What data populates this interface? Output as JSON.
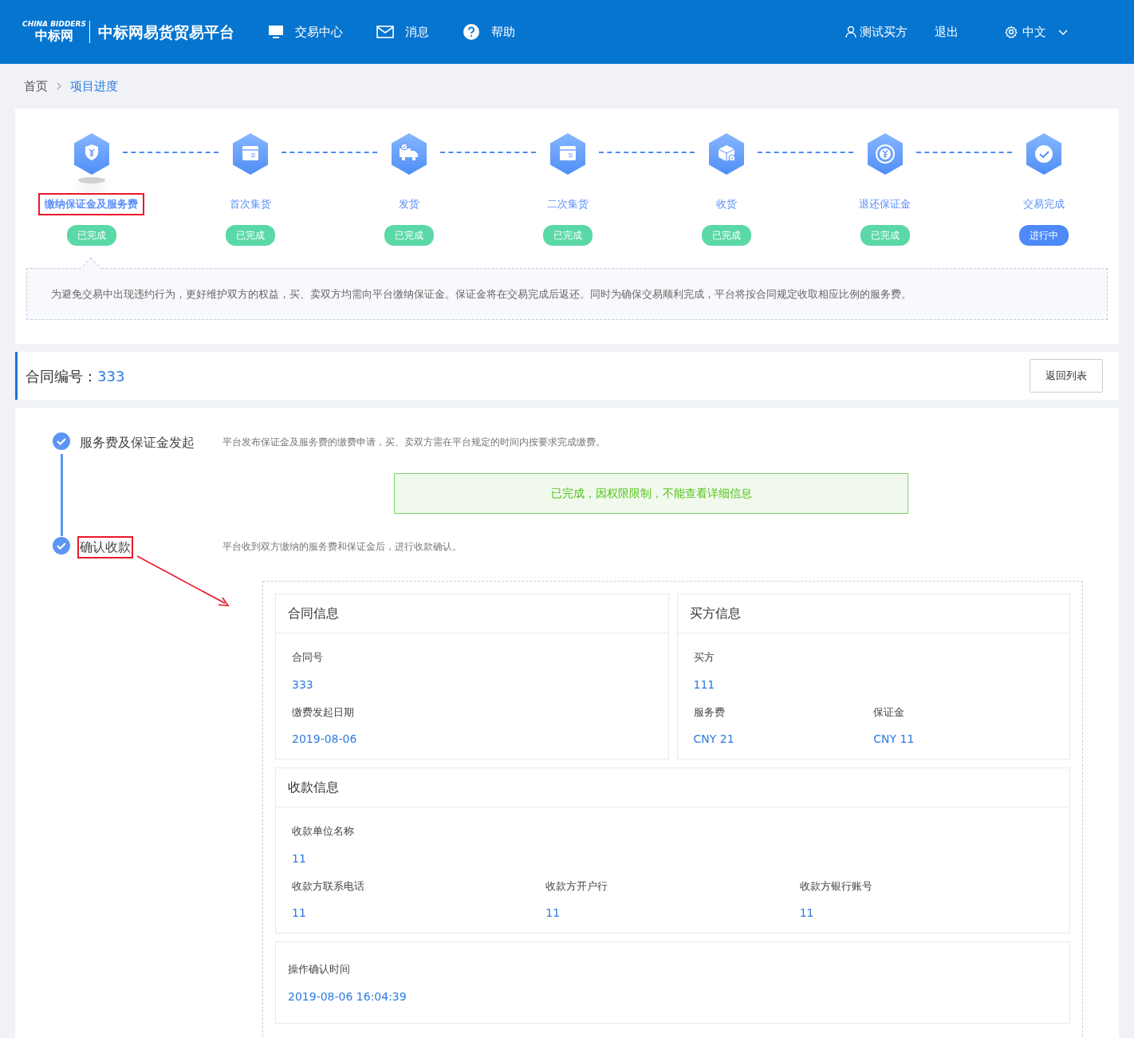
{
  "header": {
    "logo": {
      "mark": "CHINA BIDDERS",
      "name": "中标网"
    },
    "title": "中标网易货贸易平台",
    "nav": [
      {
        "kind": "monitor",
        "label": "交易中心"
      },
      {
        "kind": "mail",
        "label": "消息"
      },
      {
        "kind": "help",
        "label": "帮助"
      }
    ],
    "user": "测试买方",
    "logout": "退出",
    "language": "中文"
  },
  "breadcrumb": [
    {
      "label": "首页",
      "current": false
    },
    {
      "label": "项目进度",
      "current": true
    }
  ],
  "steps": [
    {
      "kind": "shield-yuan",
      "label": "缴纳保证金及服务费",
      "status": "已完成",
      "in_progress": false,
      "selected": true,
      "annotated": true
    },
    {
      "kind": "box",
      "label": "首次集货",
      "status": "已完成",
      "in_progress": false,
      "selected": false,
      "annotated": false
    },
    {
      "kind": "truck",
      "label": "发货",
      "status": "已完成",
      "in_progress": false,
      "selected": false,
      "annotated": false
    },
    {
      "kind": "box",
      "label": "二次集货",
      "status": "已完成",
      "in_progress": false,
      "selected": false,
      "annotated": false
    },
    {
      "kind": "box-check",
      "label": "收货",
      "status": "已完成",
      "in_progress": false,
      "selected": false,
      "annotated": false
    },
    {
      "kind": "yuan-cycle",
      "label": "退还保证金",
      "status": "已完成",
      "in_progress": false,
      "selected": false,
      "annotated": false
    },
    {
      "kind": "check",
      "label": "交易完成",
      "status": "进行中",
      "in_progress": true,
      "selected": false,
      "annotated": false
    }
  ],
  "step_note": "为避免交易中出现违约行为，更好维护双方的权益，买、卖双方均需向平台缴纳保证金。保证金将在交易完成后返还。同时为确保交易顺利完成，平台将按合同规定收取相应比例的服务费。",
  "contract": {
    "label": "合同编号：",
    "value": "333",
    "back_button": "返回列表"
  },
  "timeline": [
    {
      "title": "服务费及保证金发起",
      "description": "平台发布保证金及服务费的缴费申请，买、卖双方需在平台规定的时间内按要求完成缴费。",
      "checked": true,
      "annotated": false,
      "notice": "已完成，因权限限制，不能查看详细信息"
    },
    {
      "title": "确认收款",
      "description": "平台收到双方缴纳的服务费和保证金后，进行收款确认。",
      "checked": true,
      "annotated": true
    }
  ],
  "cards": [
    {
      "title": "合同信息",
      "rows": [
        [
          {
            "label": "合同号",
            "value": "333"
          }
        ],
        [
          {
            "label": "缴费发起日期",
            "value": "2019-08-06"
          }
        ]
      ]
    },
    {
      "title": "买方信息",
      "rows": [
        [
          {
            "label": "买方",
            "value": "111"
          }
        ],
        [
          {
            "label": "服务费",
            "value": "CNY 21"
          },
          {
            "label": "保证金",
            "value": "CNY 11"
          }
        ]
      ]
    }
  ],
  "payee": {
    "title": "收款信息",
    "rows": [
      [
        {
          "label": "收款单位名称",
          "value": "11"
        }
      ],
      [
        {
          "label": "收款方联系电话",
          "value": "11"
        },
        {
          "label": "收款方开户行",
          "value": "11"
        },
        {
          "label": "收款方银行账号",
          "value": "11"
        }
      ]
    ]
  },
  "confirm": {
    "label": "操作确认时间",
    "value": "2019-08-06 16:04:39"
  }
}
